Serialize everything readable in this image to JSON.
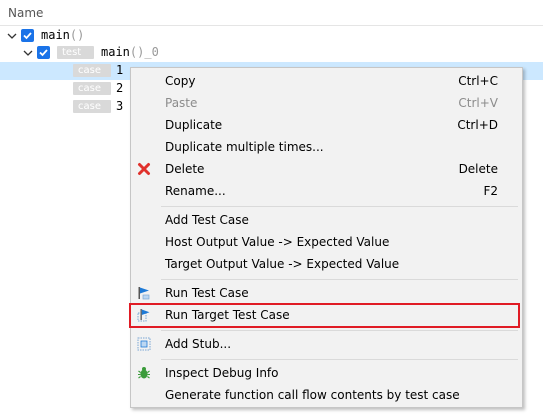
{
  "header": {
    "column_name": "Name"
  },
  "tree": {
    "root_label": "main",
    "root_suffix": "()",
    "test_tag": "test",
    "test_label": "main",
    "test_suffix": "()_0",
    "case_tag": "case",
    "cases": [
      "1",
      "2",
      "3"
    ]
  },
  "menu": {
    "copy": {
      "label": "Copy",
      "shortcut": "Ctrl+C"
    },
    "paste": {
      "label": "Paste",
      "shortcut": "Ctrl+V"
    },
    "duplicate": {
      "label": "Duplicate",
      "shortcut": "Ctrl+D"
    },
    "duplicate_multiple": {
      "label": "Duplicate multiple times..."
    },
    "delete": {
      "label": "Delete",
      "shortcut": "Delete"
    },
    "rename": {
      "label": "Rename...",
      "shortcut": "F2"
    },
    "add_test_case": {
      "label": "Add Test Case"
    },
    "host_output": {
      "label": "Host Output Value -> Expected Value"
    },
    "target_output": {
      "label": "Target Output Value -> Expected Value"
    },
    "run_test_case": {
      "label": "Run Test Case"
    },
    "run_target_test_case": {
      "label": "Run Target Test Case"
    },
    "add_stub": {
      "label": "Add Stub..."
    },
    "inspect_debug": {
      "label": "Inspect Debug Info"
    },
    "generate_flow": {
      "label": "Generate function call flow contents by test case"
    }
  },
  "colors": {
    "selection": "#cce8ff",
    "checkbox": "#1a73e8",
    "highlight_border": "#e01b24",
    "delete_icon": "#e0312c",
    "debug_icon": "#3a9b3a"
  }
}
